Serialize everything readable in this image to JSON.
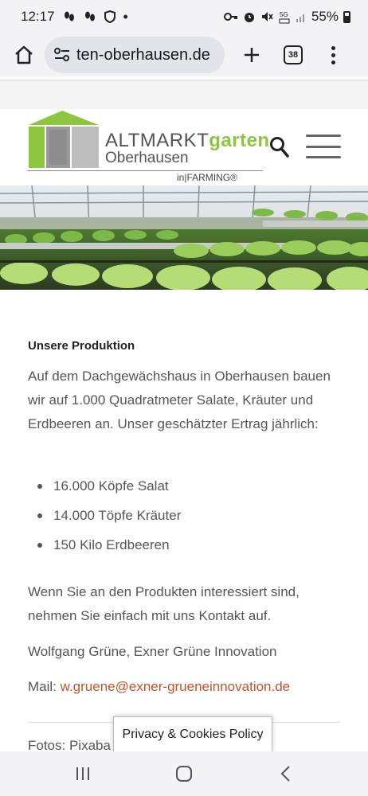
{
  "status_bar": {
    "time": "12:17",
    "battery": "55%",
    "notification_icons": [
      "footprint-icon",
      "footprint-icon",
      "shield-icon",
      "dot-icon"
    ],
    "system_icons": [
      "key-icon",
      "alarm-icon",
      "mute-icon",
      "5g-icon",
      "signal-icon",
      "battery-icon"
    ]
  },
  "browser": {
    "url": "ten-oberhausen.de",
    "tab_count": "38"
  },
  "site": {
    "logo_text_main": "ALTMARKT",
    "logo_text_accent": "garten",
    "logo_sub": "Oberhausen",
    "logo_tag": "in|FARMING®",
    "brand_green": "#8cc63f"
  },
  "content": {
    "heading": "Unsere Produktion",
    "intro": "Auf dem Dachgewächshaus in Oberhausen bauen wir auf  1.000 Quadratmeter Salate, Kräuter und Erdbeeren an. Unser geschätzter Ertrag jährlich:",
    "bullets": [
      "16.000 Köpfe Salat",
      "14.000 Töpfe Kräuter",
      "150 Kilo Erdbeeren"
    ],
    "contact_text": "Wenn Sie an den Produkten interessiert sind, nehmen Sie einfach mit uns Kontakt auf.",
    "signature": "Wolfgang Grüne, Exner Grüne Innovation",
    "mail_label": "Mail: ",
    "mail_link": "w.gruene@exner-grueneinnovation.de",
    "link_color": "#c0532b",
    "fotos_text": "Fotos: Pixaba",
    "fotos_tail": "a"
  },
  "cookie": {
    "label": "Privacy & Cookies Policy"
  }
}
